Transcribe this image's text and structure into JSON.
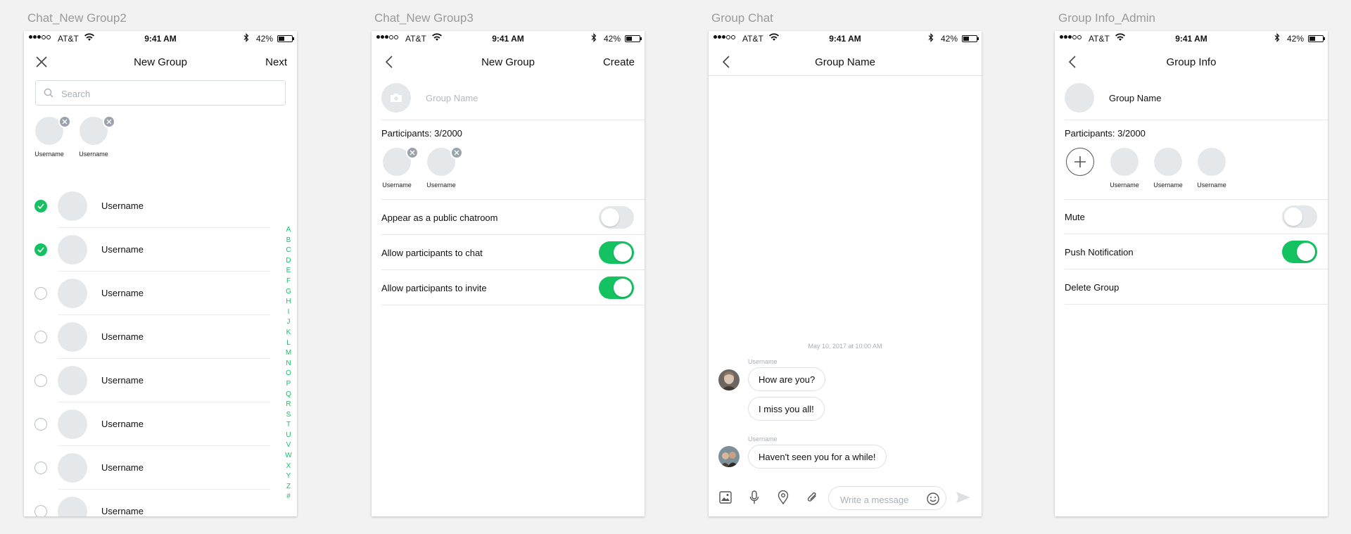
{
  "artboards": {
    "screen1": "Chat_New Group2",
    "screen2": "Chat_New Group3",
    "screen3": "Group Chat",
    "screen4": "Group Info_Admin"
  },
  "status_bar": {
    "carrier": "AT&T",
    "time": "9:41 AM",
    "battery": "42%",
    "battery_fraction": 0.42
  },
  "screen1": {
    "nav": {
      "title": "New Group",
      "right": "Next",
      "left_icon": "close-icon"
    },
    "search": {
      "placeholder": "Search",
      "value": ""
    },
    "selected": [
      {
        "name": "Username"
      },
      {
        "name": "Username"
      }
    ],
    "contacts": [
      {
        "name": "Username",
        "checked": true
      },
      {
        "name": "Username",
        "checked": true
      },
      {
        "name": "Username",
        "checked": false
      },
      {
        "name": "Username",
        "checked": false
      },
      {
        "name": "Username",
        "checked": false
      },
      {
        "name": "Username",
        "checked": false
      },
      {
        "name": "Username",
        "checked": false
      },
      {
        "name": "Username",
        "checked": false
      }
    ],
    "index": [
      "A",
      "B",
      "C",
      "D",
      "E",
      "F",
      "G",
      "H",
      "I",
      "J",
      "K",
      "L",
      "M",
      "N",
      "O",
      "P",
      "Q",
      "R",
      "S",
      "T",
      "U",
      "V",
      "W",
      "X",
      "Y",
      "Z",
      "#"
    ]
  },
  "screen2": {
    "nav": {
      "title": "New Group",
      "right": "Create",
      "left_icon": "chevron-left-icon"
    },
    "group_name_placeholder": "Group Name",
    "participants_label": "Participants: 3/2000",
    "participants": [
      {
        "name": "Username"
      },
      {
        "name": "Username"
      }
    ],
    "settings": [
      {
        "label": "Appear as a public chatroom",
        "on": false
      },
      {
        "label": "Allow participants to chat",
        "on": true
      },
      {
        "label": "Allow participants to invite",
        "on": true
      }
    ]
  },
  "screen3": {
    "nav": {
      "title": "Group Name",
      "left_icon": "chevron-left-icon"
    },
    "timestamp": "May 10, 2017 at 10:00 AM",
    "messages": [
      {
        "sender": "Username",
        "texts": [
          "How are you?",
          "I miss you all!"
        ]
      },
      {
        "sender": "Username",
        "texts": [
          "Haven't seen you for a while!"
        ]
      }
    ],
    "input_placeholder": "Write a message",
    "toolbar_icons": [
      "image-icon",
      "microphone-icon",
      "location-pin-icon",
      "attachment-icon",
      "emoji-icon",
      "send-icon"
    ]
  },
  "screen4": {
    "nav": {
      "title": "Group Info",
      "left_icon": "chevron-left-icon"
    },
    "group_name": "Group Name",
    "participants_label": "Participants: 3/2000",
    "participants": [
      {
        "name": "Username"
      },
      {
        "name": "Username"
      },
      {
        "name": "Username"
      }
    ],
    "settings": [
      {
        "label": "Mute",
        "on": false
      },
      {
        "label": "Push Notification",
        "on": true
      }
    ],
    "delete_label": "Delete Group"
  },
  "colors": {
    "accent_green": "#14c262",
    "avatar_gray": "#e5e8eb",
    "background": "#f2f2f2"
  }
}
